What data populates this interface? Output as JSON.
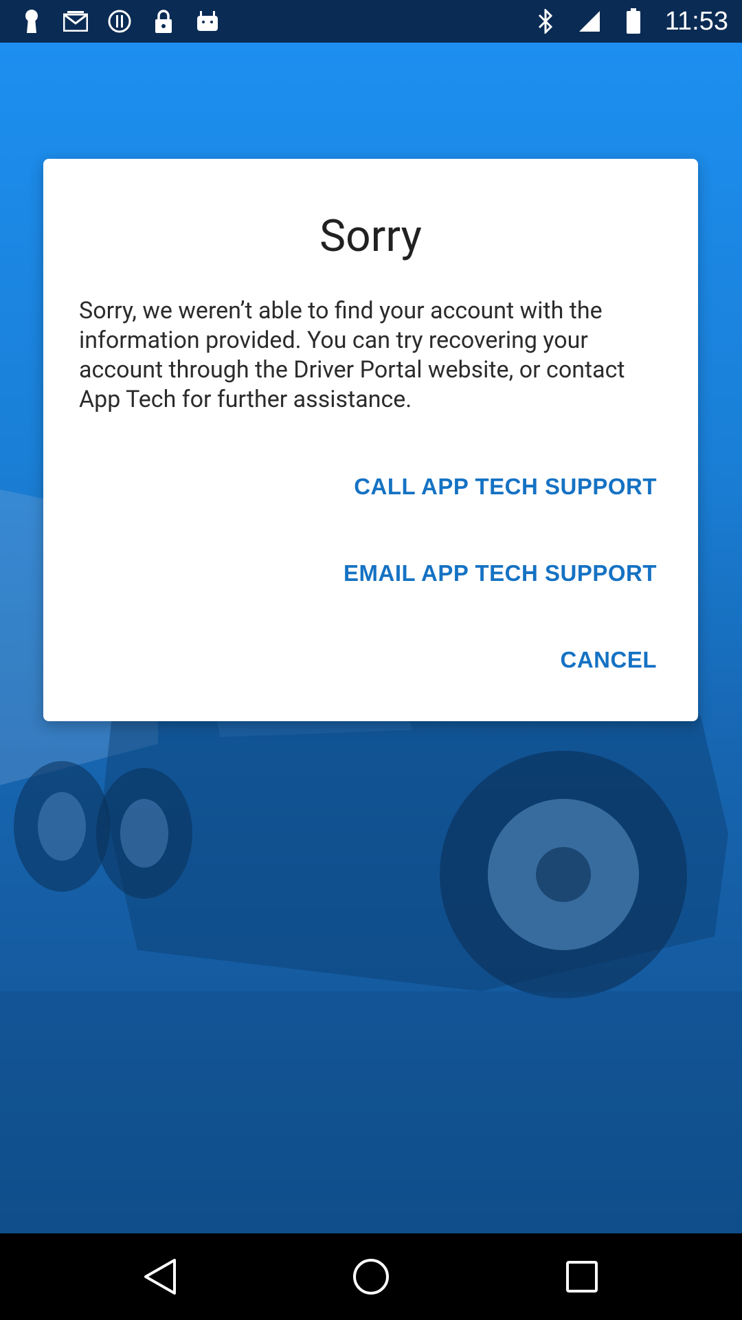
{
  "status_bar": {
    "time": "11:53",
    "left_icons": [
      "keyhole-icon",
      "mail-icon",
      "info-circle-icon",
      "lock-icon",
      "android-icon"
    ],
    "right_icons": [
      "bluetooth-icon",
      "signal-icon",
      "battery-icon"
    ]
  },
  "dialog": {
    "title": "Sorry",
    "message": "Sorry, we weren’t able to find your account with the information provided. You can try recovering your account through the Driver Portal website, or contact App Tech for further assistance.",
    "call_label": "CALL APP TECH SUPPORT",
    "email_label": "EMAIL APP TECH SUPPORT",
    "cancel_label": "CANCEL"
  },
  "nav_bar": {
    "buttons": [
      "back-icon",
      "home-icon",
      "recents-icon"
    ]
  },
  "colors": {
    "accent": "#1572c3",
    "status_bar": "#0a2b54",
    "background_top": "#1d8ff0",
    "background_bottom": "#12508f"
  }
}
